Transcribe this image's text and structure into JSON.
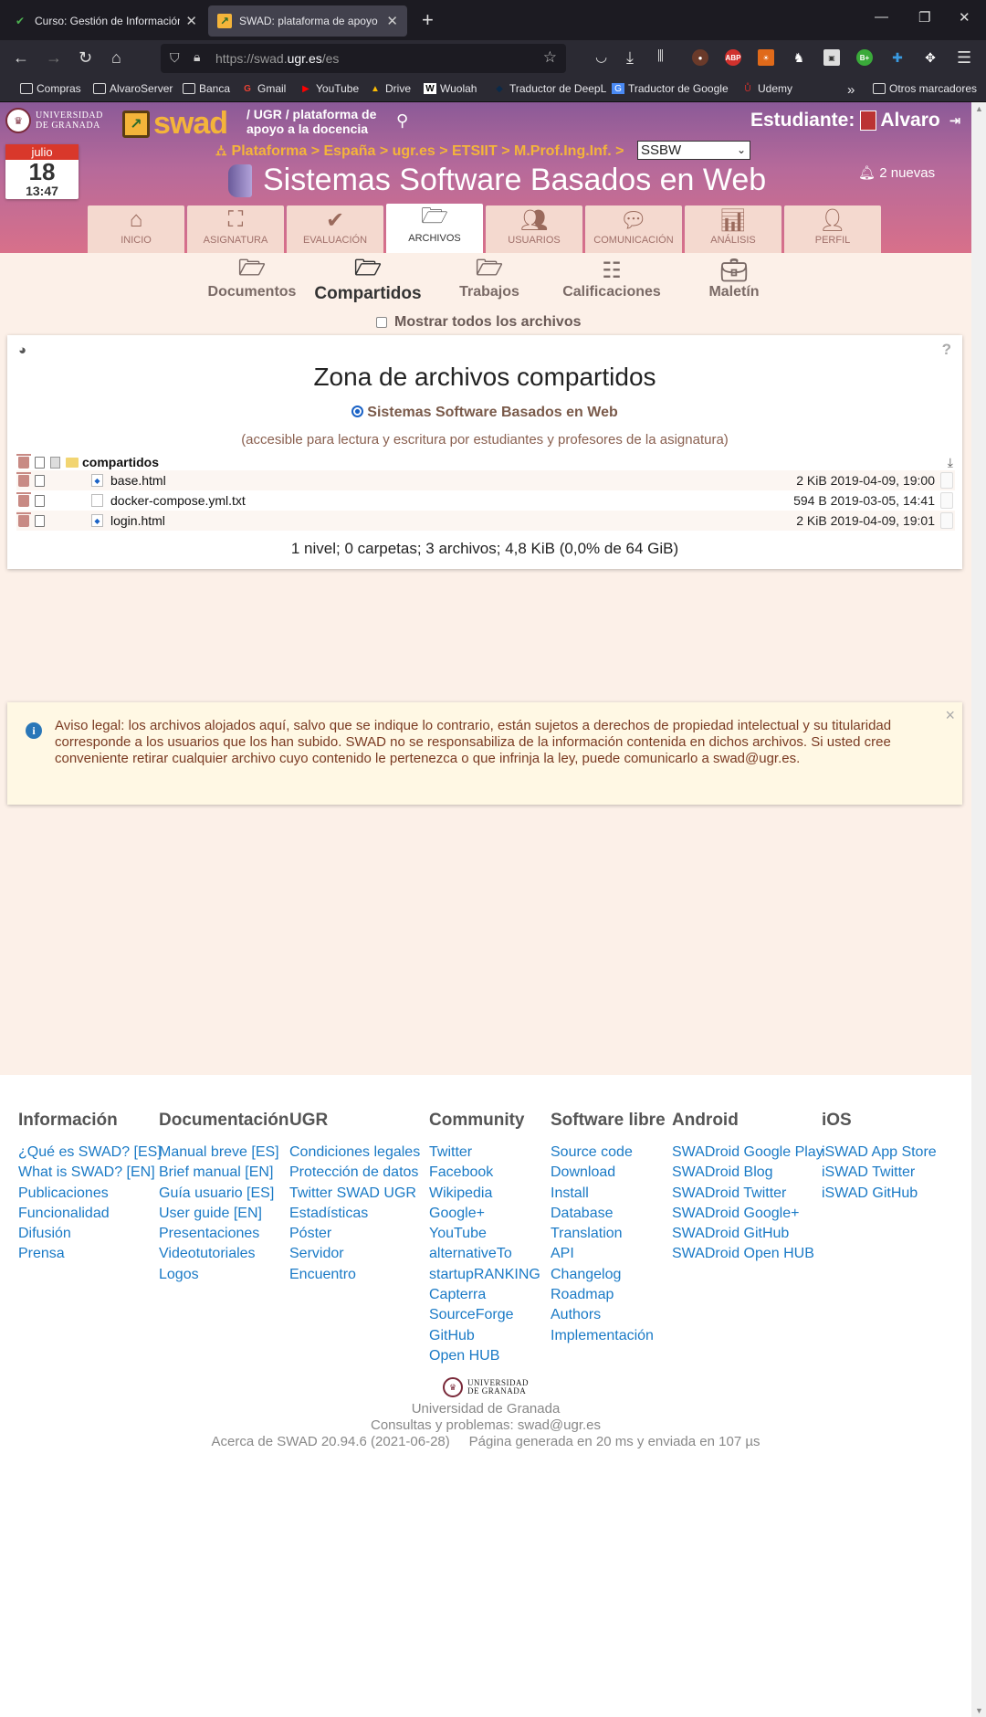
{
  "browser": {
    "tabs": [
      {
        "title": "Curso: Gestión de Información en la Web",
        "active": false
      },
      {
        "title": "SWAD: plataforma de apoyo a la docencia",
        "active": true
      }
    ],
    "url_prefix": "https://swad.",
    "url_domain": "ugr.es",
    "url_suffix": "/es",
    "bookmarks": [
      "Compras",
      "AlvaroServer",
      "Banca",
      "Gmail",
      "YouTube",
      "Drive",
      "Wuolah",
      "Traductor de DeepL",
      "Traductor de Google",
      "Udemy"
    ],
    "other_bookmarks": "Otros marcadores",
    "extensions": [
      "ABP",
      "B+"
    ]
  },
  "header": {
    "university_line1": "UNIVERSIDAD",
    "university_line2": "DE GRANADA",
    "swad": "swad",
    "tagline": "/ UGR / plataforma de apoyo a la docencia",
    "role_label": "Estudiante:",
    "user_name": "Alvaro",
    "calendar_month": "julio",
    "calendar_day": "18",
    "calendar_time": "13:47",
    "breadcrumb": "Plataforma > España > ugr.es > ETSIIT > M.Prof.Ing.Inf. >",
    "course_select": "SSBW",
    "course_title": "Sistemas Software Basados en Web",
    "notifications": "2 nuevas"
  },
  "main_tabs": [
    {
      "label": "INICIO",
      "icon": "home-icon",
      "selected": false
    },
    {
      "label": "ASIGNATURA",
      "icon": "presentation-icon",
      "selected": false
    },
    {
      "label": "EVALUACIÓN",
      "icon": "check-icon",
      "selected": false
    },
    {
      "label": "ARCHIVOS",
      "icon": "folder-open-icon",
      "selected": true
    },
    {
      "label": "USUARIOS",
      "icon": "users-icon",
      "selected": false
    },
    {
      "label": "COMUNICACIÓN",
      "icon": "chat-icon",
      "selected": false
    },
    {
      "label": "ANÁLISIS",
      "icon": "chart-icon",
      "selected": false
    },
    {
      "label": "PERFIL",
      "icon": "user-icon",
      "selected": false
    }
  ],
  "sub_tabs": [
    {
      "label": "Documentos",
      "selected": false
    },
    {
      "label": "Compartidos",
      "selected": true
    },
    {
      "label": "Trabajos",
      "selected": false
    },
    {
      "label": "Calificaciones",
      "selected": false
    },
    {
      "label": "Maletín",
      "selected": false
    }
  ],
  "show_all": "Mostrar todos los archivos",
  "zone": {
    "title": "Zona de archivos compartidos",
    "course_radio": "Sistemas Software Basados en Web",
    "access_note": "(accesible para lectura y escritura por estudiantes y profesores de la asignatura)",
    "root_folder": "compartidos",
    "files": [
      {
        "name": "base.html",
        "meta": "2 KiB 2019-04-09, 19:00"
      },
      {
        "name": "docker-compose.yml.txt",
        "meta": "594 B 2019-03-05, 14:41"
      },
      {
        "name": "login.html",
        "meta": "2 KiB 2019-04-09, 19:01"
      }
    ],
    "summary": "1 nivel; 0 carpetas; 3 archivos; 4,8 KiB (0,0% de 64 GiB)"
  },
  "legal_notice": "Aviso legal: los archivos alojados aquí, salvo que se indique lo contrario, están sujetos a derechos de propiedad intelectual y su titularidad corresponde a los usuarios que los han subido. SWAD no se responsabiliza de la información contenida en dichos archivos. Si usted cree conveniente retirar cualquier archivo cuyo contenido le pertenezca o que infrinja la ley, puede comunicarlo a swad@ugr.es.",
  "footer": {
    "columns": [
      {
        "title": "Información",
        "links": [
          "¿Qué es SWAD? [ES]",
          "What is SWAD? [EN]",
          "Publicaciones",
          "Funcionalidad",
          "Difusión",
          "Prensa"
        ]
      },
      {
        "title": "Documentación",
        "links": [
          "Manual breve [ES]",
          "Brief manual [EN]",
          "Guía usuario [ES]",
          "User guide [EN]",
          "Presentaciones",
          "Videotutoriales",
          "Logos"
        ]
      },
      {
        "title": "UGR",
        "links": [
          "Condiciones legales",
          "Protección de datos",
          "Twitter SWAD UGR",
          "Estadísticas",
          "Póster",
          "Servidor",
          "Encuentro"
        ]
      },
      {
        "title": "Community",
        "links": [
          "Twitter",
          "Facebook",
          "Wikipedia",
          "Google+",
          "YouTube",
          "alternativeTo",
          "startupRANKING",
          "Capterra",
          "SourceForge",
          "GitHub",
          "Open HUB"
        ]
      },
      {
        "title": "Software libre",
        "links": [
          "Source code",
          "Download",
          "Install",
          "Database",
          "Translation",
          "API",
          "Changelog",
          "Roadmap",
          "Authors",
          "Implementación"
        ]
      },
      {
        "title": "Android",
        "links": [
          "SWADroid Google Play",
          "SWADroid Blog",
          "SWADroid Twitter",
          "SWADroid Google+",
          "SWADroid GitHub",
          "SWADroid Open HUB"
        ]
      },
      {
        "title": "iOS",
        "links": [
          "iSWAD App Store",
          "iSWAD Twitter",
          "iSWAD GitHub"
        ]
      }
    ],
    "ugr_logo_line1": "UNIVERSIDAD",
    "ugr_logo_line2": "DE GRANADA",
    "university": "Universidad de Granada",
    "contact": "Consultas y problemas: swad@ugr.es",
    "about": "Acerca de SWAD 20.94.6 (2021-06-28)",
    "generated": "Página generada en 20 ms y enviada en 107 µs"
  }
}
